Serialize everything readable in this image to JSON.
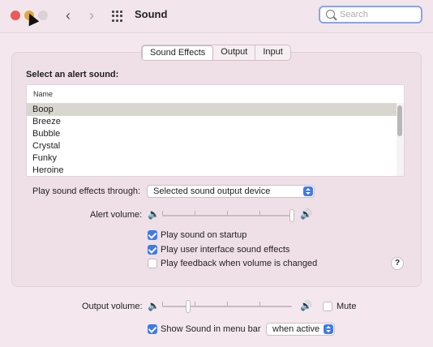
{
  "window": {
    "title": "Sound",
    "search_placeholder": "Search"
  },
  "tabs": [
    {
      "label": "Sound Effects",
      "active": true
    },
    {
      "label": "Output",
      "active": false
    },
    {
      "label": "Input",
      "active": false
    }
  ],
  "alert": {
    "section_label": "Select an alert sound:",
    "column_header": "Name",
    "sounds": [
      "Boop",
      "Breeze",
      "Bubble",
      "Crystal",
      "Funky",
      "Heroine"
    ],
    "selected": "Boop"
  },
  "effects_through": {
    "label": "Play sound effects through:",
    "value": "Selected sound output device"
  },
  "alert_volume": {
    "label": "Alert volume:",
    "level": 1.0
  },
  "checkboxes": [
    {
      "label": "Play sound on startup",
      "checked": true
    },
    {
      "label": "Play user interface sound effects",
      "checked": true
    },
    {
      "label": "Play feedback when volume is changed",
      "checked": false
    }
  ],
  "help": "?",
  "output_volume": {
    "label": "Output volume:",
    "level": 0.2,
    "mute_label": "Mute",
    "muted": false
  },
  "menu_bar": {
    "label": "Show Sound in menu bar",
    "checked": true,
    "option": "when active"
  },
  "colors": {
    "accent": "#3f7ae8",
    "close": "#ec5b57",
    "minimize": "#dfaa3c",
    "zoom": "#dcd2d6"
  },
  "icons": {
    "speaker_low": "speaker-low-icon",
    "speaker_high": "speaker-high-icon",
    "grid": "grid-icon",
    "search": "search-icon"
  }
}
